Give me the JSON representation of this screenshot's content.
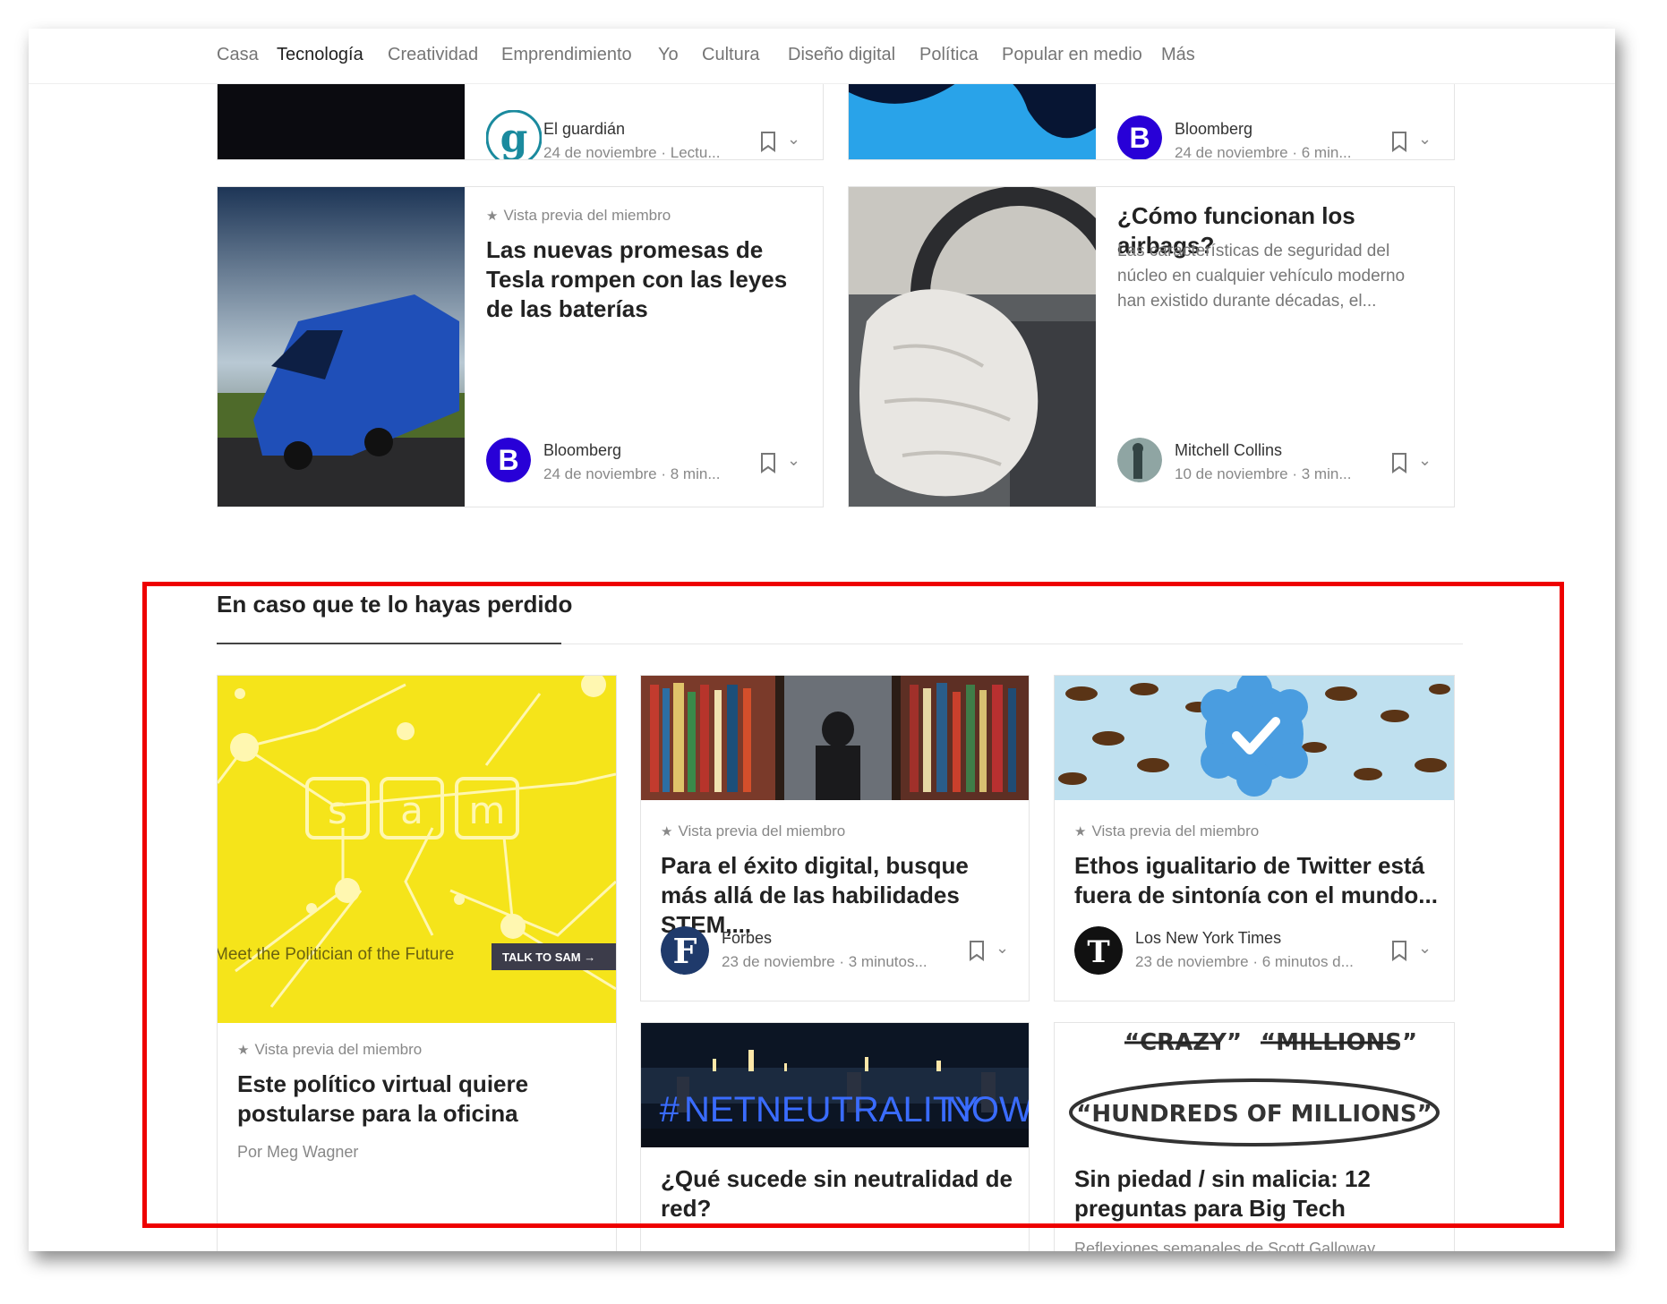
{
  "nav": {
    "items": [
      "Casa",
      "Tecnología",
      "Creatividad",
      "Emprendimiento",
      "Yo",
      "Cultura",
      "Diseño digital",
      "Política",
      "Popular en medio",
      "Más"
    ],
    "active": "Tecnología"
  },
  "top_cards": [
    {
      "publisher": "El guardián",
      "meta": "24 de noviembre · Lectu..."
    },
    {
      "publisher": "Bloomberg",
      "meta": "24 de noviembre · 6 min..."
    }
  ],
  "row_cards": [
    {
      "badge": "Vista previa del miembro",
      "title": "Las nuevas promesas de Tesla rompen con las leyes de las baterías",
      "publisher": "Bloomberg",
      "meta": "24 de noviembre · 8 min..."
    },
    {
      "title": "¿Cómo funcionan los airbags?",
      "desc": "Las características de seguridad del núcleo en cualquier vehículo moderno han existido durante décadas, el...",
      "publisher": "Mitchell Collins",
      "meta": "10 de noviembre · 3 min..."
    }
  ],
  "section": {
    "title": "En caso que te lo hayas perdido"
  },
  "missed": {
    "big": {
      "image_text": {
        "letters": [
          "s",
          "a",
          "m"
        ],
        "tagline": "Meet the Politician of the Future",
        "cta": "TALK TO SAM →"
      },
      "badge": "Vista previa del miembro",
      "title": "Este político virtual quiere postularse para la oficina",
      "byline": "Por Meg Wagner"
    },
    "stem": {
      "badge": "Vista previa del miembro",
      "title": "Para el éxito digital, busque más allá de las habilidades STEM,...",
      "publisher": "Forbes",
      "meta": "23 de noviembre · 3 minutos..."
    },
    "twitter": {
      "badge": "Vista previa del miembro",
      "title": "Ethos igualitario de Twitter está fuera de sintonía con el mundo...",
      "publisher": "Los New York Times",
      "meta": "23 de noviembre · 6 minutos d..."
    },
    "net": {
      "image_text": "# NET NEUTRALITY NOW",
      "title": "¿Qué sucede sin neutralidad de red?"
    },
    "galloway": {
      "image_text": {
        "a": "“CRAZY”",
        "b": "“MILLIONS”",
        "c": "“HUNDREDS OF MILLIONS”"
      },
      "title": "Sin piedad / sin malicia: 12 preguntas para Big Tech",
      "publisher": "Reflexiones semanales de Scott Galloway"
    }
  },
  "colors": {
    "accent_red": "#ee0000",
    "bloomberg": "#2800d7",
    "sam_yellow": "#f5e41a"
  }
}
